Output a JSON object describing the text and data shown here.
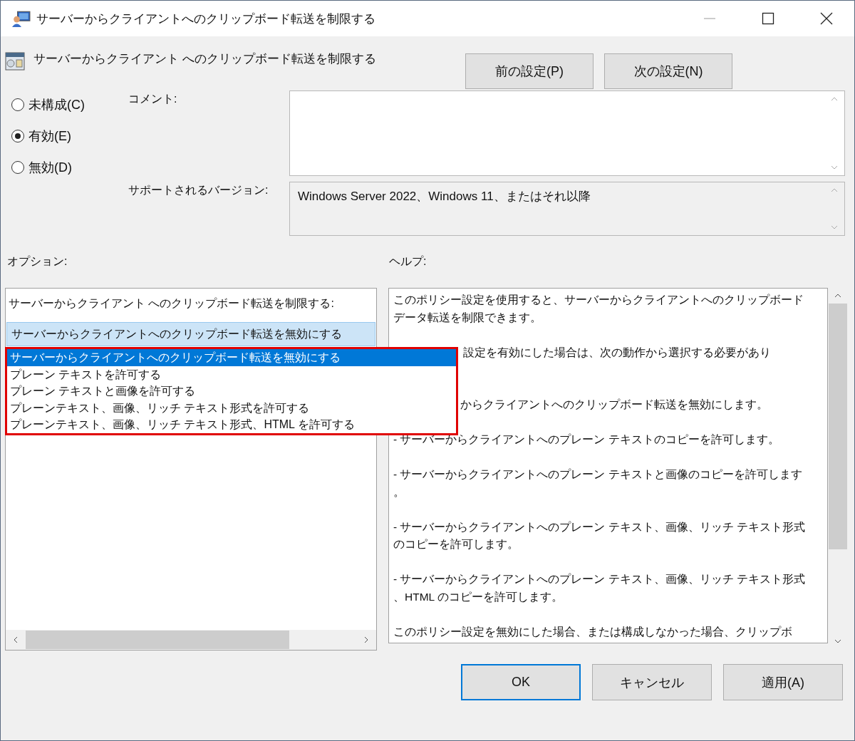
{
  "window": {
    "title": "サーバーからクライアントへのクリップボード転送を制限する"
  },
  "policy": {
    "title": "サーバーからクライアント へのクリップボード転送を制限する"
  },
  "nav_buttons": [
    "前の設定(P)",
    "次の設定(N)"
  ],
  "state_options": [
    {
      "label": "未構成(C)",
      "selected": false
    },
    {
      "label": "有効(E)",
      "selected": true
    },
    {
      "label": "無効(D)",
      "selected": false
    }
  ],
  "comment": {
    "label": "コメント:"
  },
  "supported": {
    "label": "サポートされるバージョン:",
    "value": "Windows Server 2022、Windows 11、またはそれ以降"
  },
  "options": {
    "label": "オプション:",
    "setting_label": "サーバーからクライアント へのクリップボード転送を制限する:",
    "combo_value": "サーバーからクライアントへのクリップボード転送を無効にする",
    "dropdown_items": [
      {
        "text": "サーバーからクライアントへのクリップボード転送を無効にする",
        "selected": true
      },
      {
        "text": "プレーン テキストを許可する",
        "selected": false
      },
      {
        "text": "プレーン テキストと画像を許可する",
        "selected": false
      },
      {
        "text": "プレーンテキスト、画像、リッチ テキスト形式を許可する",
        "selected": false
      },
      {
        "text": "プレーンテキスト、画像、リッチ テキスト形式、HTML を許可する",
        "selected": false
      }
    ]
  },
  "help": {
    "label": "ヘルプ:",
    "paragraphs": [
      {
        "kind": "full",
        "lines": [
          "このポリシー設定を使用すると、サーバーからクライアントへのクリップボード",
          "データ転送を制限できます。"
        ]
      },
      {
        "kind": "covered",
        "lines": [
          "設定を有効にした場合は、次の動作から選択する必要があり"
        ]
      },
      {
        "kind": "partial",
        "lines": [
          "からクライアントへのクリップボード転送を無効にします。"
        ]
      },
      {
        "kind": "full",
        "lines": [
          "- サーバーからクライアントへのプレーン テキストのコピーを許可します。"
        ]
      },
      {
        "kind": "full",
        "lines": [
          "- サーバーからクライアントへのプレーン テキストと画像のコピーを許可します",
          "。"
        ]
      },
      {
        "kind": "full",
        "lines": [
          "- サーバーからクライアントへのプレーン テキスト、画像、リッチ テキスト形式",
          "のコピーを許可します。"
        ]
      },
      {
        "kind": "full",
        "lines": [
          "- サーバーからクライアントへのプレーン テキスト、画像、リッチ テキスト形式",
          "、HTML のコピーを許可します。"
        ]
      },
      {
        "kind": "full",
        "lines": [
          "このポリシー設定を無効にした場合、または構成しなかった場合、クリップボ"
        ]
      }
    ]
  },
  "buttons": [
    "OK",
    "キャンセル",
    "適用(A)"
  ]
}
